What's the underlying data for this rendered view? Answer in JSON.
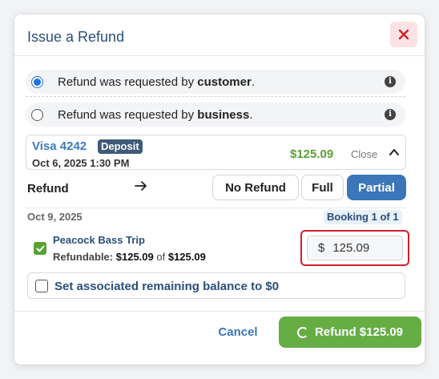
{
  "dialog": {
    "title": "Issue a Refund"
  },
  "options": [
    {
      "prefix": "Refund was requested by ",
      "who": "customer",
      "suffix": ".",
      "selected": true
    },
    {
      "prefix": "Refund was requested by ",
      "who": "business",
      "suffix": ".",
      "selected": false
    }
  ],
  "payment": {
    "card": "Visa 4242",
    "badge": "Deposit",
    "date": "Oct 6, 2025 1:30 PM",
    "amount": "$125.09",
    "toggle_label": "Close"
  },
  "refund_type": {
    "label": "Refund",
    "buttons": [
      "No Refund",
      "Full",
      "Partial"
    ],
    "active": "Partial"
  },
  "booking": {
    "date": "Oct 9, 2025",
    "badge": "Booking 1 of 1",
    "trip_name": "Peacock Bass Trip",
    "refundable_label": "Refundable:",
    "refundable_amount": "$125.09",
    "of_text": "of",
    "total_amount": "$125.09",
    "checked": true,
    "currency_symbol": "$",
    "input_value": "125.09"
  },
  "balance": {
    "label": "Set associated remaining balance to $0",
    "checked": false
  },
  "footer": {
    "cancel_label": "Cancel",
    "submit_label": "Refund $125.09"
  },
  "colors": {
    "title": "#2a4f7a",
    "accent_blue": "#3a76b8",
    "green": "#66ad44",
    "amount_green": "#57a234",
    "error_red": "#d3202a",
    "close_bg": "#fbe3e4"
  },
  "icons": [
    "close-icon",
    "info-icon",
    "chevron-up-icon",
    "arrow-right-icon",
    "check-icon",
    "spinner-icon"
  ]
}
